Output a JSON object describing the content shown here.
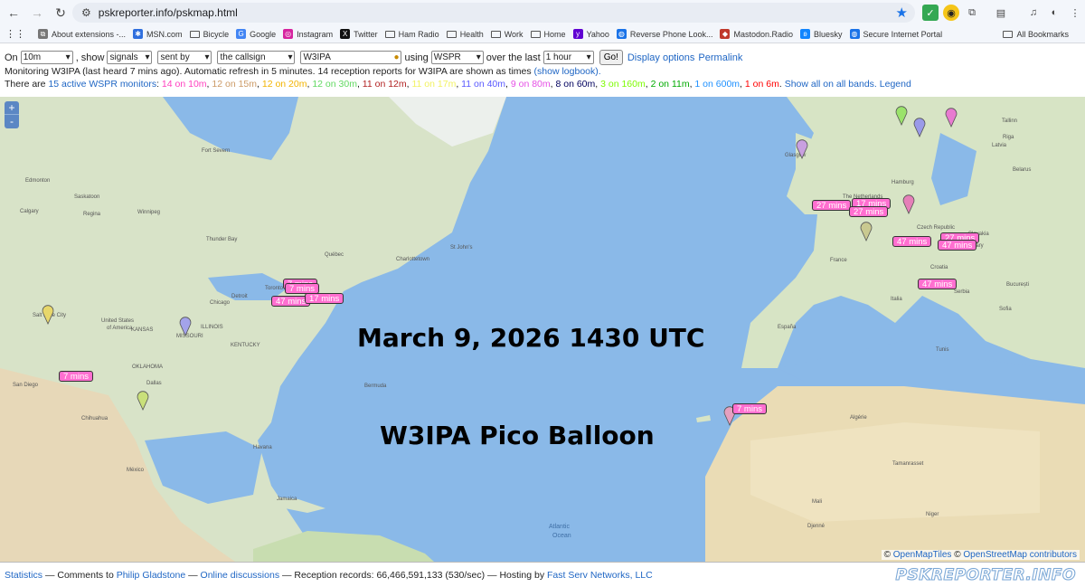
{
  "browser": {
    "url": "pskreporter.info/pskmap.html",
    "bookmarks": [
      {
        "label": "About extensions -...",
        "icon": "puzzle-icon"
      },
      {
        "label": "MSN.com",
        "icon": "msn-icon"
      },
      {
        "label": "Bicycle",
        "icon": "folder-icon"
      },
      {
        "label": "Google",
        "icon": "google-icon"
      },
      {
        "label": "Instagram",
        "icon": "instagram-icon"
      },
      {
        "label": "Twitter",
        "icon": "x-icon"
      },
      {
        "label": "Ham Radio",
        "icon": "folder-icon"
      },
      {
        "label": "Health",
        "icon": "folder-icon"
      },
      {
        "label": "Work",
        "icon": "folder-icon"
      },
      {
        "label": "Home",
        "icon": "folder-icon"
      },
      {
        "label": "Yahoo",
        "icon": "yahoo-icon"
      },
      {
        "label": "Reverse Phone Look...",
        "icon": "globe-icon"
      },
      {
        "label": "Mastodon.Radio",
        "icon": "mastodon-icon"
      },
      {
        "label": "Bluesky",
        "icon": "butterfly-icon"
      },
      {
        "label": "Secure Internet Portal",
        "icon": "globe-icon"
      }
    ],
    "all_bookmarks": "All Bookmarks"
  },
  "controls": {
    "on_label": "On",
    "band": "10m",
    "show_label": ", show",
    "show": "signals",
    "direction": "sent by",
    "who": "the callsign",
    "callsign": "W3IPA",
    "using_label": "using",
    "mode": "WSPR",
    "over_label": "over the last",
    "period": "1 hour",
    "go": "Go!",
    "display_options": "Display options",
    "permalink": "Permalink"
  },
  "status": {
    "monitoring": "Monitoring W3IPA (last heard 7 mins ago). Automatic refresh in 5 minutes. 14 reception reports for W3IPA are shown as times",
    "logbook": "(show logbook).",
    "there_are": "There are",
    "monitors_link": "15 active WSPR monitors",
    "bands": [
      {
        "text": "14 on 10m",
        "color": "#ff3fbf"
      },
      {
        "text": "12 on 15m",
        "color": "#cc9a66"
      },
      {
        "text": "12 on 20m",
        "color": "#f2b300"
      },
      {
        "text": "12 on 30m",
        "color": "#62d962"
      },
      {
        "text": "11 on 12m",
        "color": "#b22222"
      },
      {
        "text": "11 on 17m",
        "color": "#f2f261"
      },
      {
        "text": "11 on 40m",
        "color": "#5959ff"
      },
      {
        "text": "9 on 80m",
        "color": "#e550e5"
      },
      {
        "text": "8 on 60m",
        "color": "#00005e"
      },
      {
        "text": "3 on 160m",
        "color": "#7cfc00"
      },
      {
        "text": "2 on 11m",
        "color": "#00aa00"
      },
      {
        "text": "1 on 600m",
        "color": "#1e90ff"
      },
      {
        "text": "1 on 6m",
        "color": "#ff0000"
      }
    ],
    "show_all": "Show all on all bands.",
    "legend": "Legend"
  },
  "map": {
    "zoom_in": "+",
    "zoom_out": "-",
    "overlay_title": "March 9, 2026 1430 UTC",
    "overlay_subtitle": "W3IPA Pico Balloon",
    "attribution_prefix": "©",
    "openmaptiles": "OpenMapTiles",
    "osm": "OpenStreetMap contributors",
    "report_labels": [
      {
        "text": "7 mins"
      },
      {
        "text": "7 mins"
      },
      {
        "text": "47 mins"
      },
      {
        "text": "17 mins"
      },
      {
        "text": "7 mins"
      },
      {
        "text": "27 mins"
      },
      {
        "text": "17 mins"
      },
      {
        "text": "27 mins"
      },
      {
        "text": "47 mins"
      },
      {
        "text": "27 mins"
      },
      {
        "text": "47 mins"
      },
      {
        "text": "47 mins"
      },
      {
        "text": "7 mins"
      }
    ],
    "place_labels": {
      "fort_severn": "Fort Severn",
      "edmonton": "Edmonton",
      "saskatoon": "Saskatoon",
      "calgary": "Calgary",
      "regina": "Regina",
      "winnipeg": "Winnipeg",
      "thunder_bay": "Thunder Bay",
      "quebec": "Québec",
      "charlottetown": "Charlottetown",
      "st_johns": "St John's",
      "toronto": "Toronto",
      "chicago": "Chicago",
      "detroit": "Detroit",
      "salt_lake": "Salt Lake City",
      "united_states": "United States",
      "of_america": "of America",
      "missouri": "MISSOURI",
      "kansas": "KANSAS",
      "illinois": "ILLINOIS",
      "kentucky": "KENTUCKY",
      "oklahoma": "OKLAHOMA",
      "dallas": "Dallas",
      "san_diego": "San Diego",
      "chihuahua": "Chihuahua",
      "mexico": "México",
      "havana": "Havana",
      "jamaica": "Jamaica",
      "bermuda": "Bermuda",
      "atlantic": "Atlantic",
      "ocean": "Ocean",
      "glasgow": "Glasgow",
      "france": "France",
      "italia": "Italia",
      "espana": "España",
      "latvia": "Latvia",
      "belarus": "Belarus",
      "czech": "Czech Republic",
      "croatia": "Croatia",
      "serbia": "Serbia",
      "bucuresti": "București",
      "sofia": "Sofia",
      "algerie": "Algérie",
      "tamanrasset": "Tamanrasset",
      "mali": "Mali",
      "niger": "Niger",
      "djenne": "Djenné",
      "tunis": "Tunis",
      "hamburg": "Hamburg",
      "the_netherlands": "The Netherlands",
      "tallinn": "Tallinn",
      "riga": "Riga",
      "slovakia": "Slovakia",
      "hungary": "Hungary"
    }
  },
  "footer": {
    "statistics": "Statistics",
    "sep1": "— Comments to",
    "author": "Philip Gladstone",
    "sep2": "—",
    "discussions": "Online discussions",
    "records": "— Reception records: 66,466,591,133 (530/sec) — Hosting by",
    "host": "Fast Serv Networks, LLC",
    "brand": "PSKREPORTER.INFO"
  }
}
